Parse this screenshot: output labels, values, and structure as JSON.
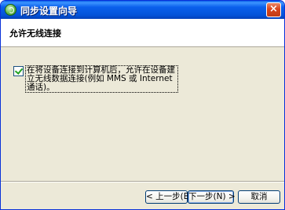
{
  "window": {
    "title": "同步设置向导",
    "close_glyph": "×"
  },
  "header": {
    "title": "允许无线连接"
  },
  "option": {
    "checked": true,
    "label": "在将设备连接到计算机后，允许在设备建立无线数据连接(例如 MMS 或 Internet 通话)。"
  },
  "buttons": {
    "back": "< 上一步(B)",
    "next": "下一步(N) >",
    "cancel": "取消"
  },
  "icons": {
    "app": "sync-icon",
    "close": "close-icon",
    "checkbox": "checkmark-icon"
  }
}
